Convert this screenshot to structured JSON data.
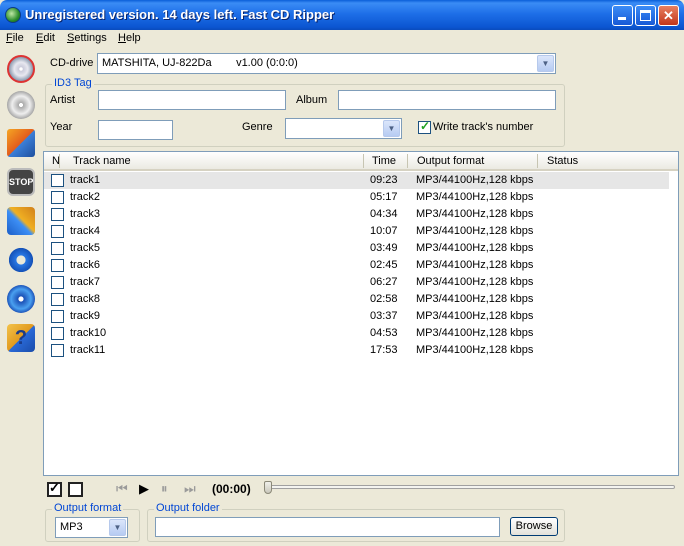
{
  "window": {
    "title": "Unregistered version. 14 days left. Fast CD Ripper",
    "controls": {
      "minimize": "minimize",
      "maximize": "maximize",
      "close": "✕"
    }
  },
  "menu": {
    "items": [
      {
        "accel": "F",
        "rest": "ile"
      },
      {
        "accel": "E",
        "rest": "dit"
      },
      {
        "accel": "S",
        "rest": "ettings"
      },
      {
        "accel": "H",
        "rest": "elp"
      }
    ]
  },
  "toolbar": {
    "icons": [
      "rip-icon",
      "cd-icon",
      "box-icon",
      "stop-icon",
      "tools-icon",
      "gear-icon",
      "disc-icon",
      "help-icon"
    ],
    "stop_label": "STOP",
    "help_label": "?"
  },
  "cd_drive": {
    "label": "CD-drive",
    "value": "MATSHITA, UJ-822Da        v1.00 (0:0:0)"
  },
  "id3": {
    "caption": "ID3 Tag",
    "artist_label": "Artist",
    "artist_value": "",
    "album_label": "Album",
    "album_value": "",
    "year_label": "Year",
    "year_value": "",
    "genre_label": "Genre",
    "genre_value": "",
    "write_track_label": "Write track's number",
    "write_track_checked": true
  },
  "tracklist": {
    "columns": [
      "N",
      "Track name",
      "Time",
      "Output format",
      "Status"
    ],
    "rows": [
      {
        "name": "track1",
        "time": "09:23",
        "format": "MP3/44100Hz,128 kbps",
        "status": "",
        "selected": true
      },
      {
        "name": "track2",
        "time": "05:17",
        "format": "MP3/44100Hz,128 kbps",
        "status": ""
      },
      {
        "name": "track3",
        "time": "04:34",
        "format": "MP3/44100Hz,128 kbps",
        "status": ""
      },
      {
        "name": "track4",
        "time": "10:07",
        "format": "MP3/44100Hz,128 kbps",
        "status": ""
      },
      {
        "name": "track5",
        "time": "03:49",
        "format": "MP3/44100Hz,128 kbps",
        "status": ""
      },
      {
        "name": "track6",
        "time": "02:45",
        "format": "MP3/44100Hz,128 kbps",
        "status": ""
      },
      {
        "name": "track7",
        "time": "06:27",
        "format": "MP3/44100Hz,128 kbps",
        "status": ""
      },
      {
        "name": "track8",
        "time": "02:58",
        "format": "MP3/44100Hz,128 kbps",
        "status": ""
      },
      {
        "name": "track9",
        "time": "03:37",
        "format": "MP3/44100Hz,128 kbps",
        "status": ""
      },
      {
        "name": "track10",
        "time": "04:53",
        "format": "MP3/44100Hz,128 kbps",
        "status": ""
      },
      {
        "name": "track11",
        "time": "17:53",
        "format": "MP3/44100Hz,128 kbps",
        "status": ""
      }
    ]
  },
  "player": {
    "time": "(00:00)",
    "prev": "⏮",
    "play": "▶",
    "pause": "⏸",
    "next": "⏭",
    "position": 0
  },
  "output": {
    "format_caption": "Output format",
    "format_value": "MP3",
    "folder_caption": "Output folder",
    "folder_value": "",
    "browse_label": "Browse"
  }
}
